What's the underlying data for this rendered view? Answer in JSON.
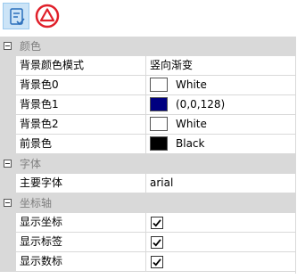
{
  "toolbar": {
    "buttons": [
      {
        "icon": "categorized-view-icon",
        "active": true
      },
      {
        "icon": "warning-triangle-icon",
        "active": false
      }
    ]
  },
  "colors": {
    "gutter": "#d9d9d9",
    "category_text": "#7f7f7f",
    "accent_red": "#e0202a",
    "active_button": "#cce4f7"
  },
  "categories": [
    {
      "name": "颜色",
      "props": [
        {
          "name": "背景颜色模式",
          "value": "竖向渐变",
          "kind": "text"
        },
        {
          "name": "背景色0",
          "value": "White",
          "kind": "color",
          "swatch": "#ffffff"
        },
        {
          "name": "背景色1",
          "value": "(0,0,128)",
          "kind": "color",
          "swatch": "#000080"
        },
        {
          "name": "背景色2",
          "value": "White",
          "kind": "color",
          "swatch": "#ffffff"
        },
        {
          "name": "前景色",
          "value": "Black",
          "kind": "color",
          "swatch": "#000000"
        }
      ]
    },
    {
      "name": "字体",
      "props": [
        {
          "name": "主要字体",
          "value": "arial",
          "kind": "text"
        }
      ]
    },
    {
      "name": "坐标轴",
      "props": [
        {
          "name": "显示坐标",
          "value": true,
          "kind": "check"
        },
        {
          "name": "显示标签",
          "value": true,
          "kind": "check"
        },
        {
          "name": "显示数标",
          "value": true,
          "kind": "check"
        }
      ]
    }
  ]
}
